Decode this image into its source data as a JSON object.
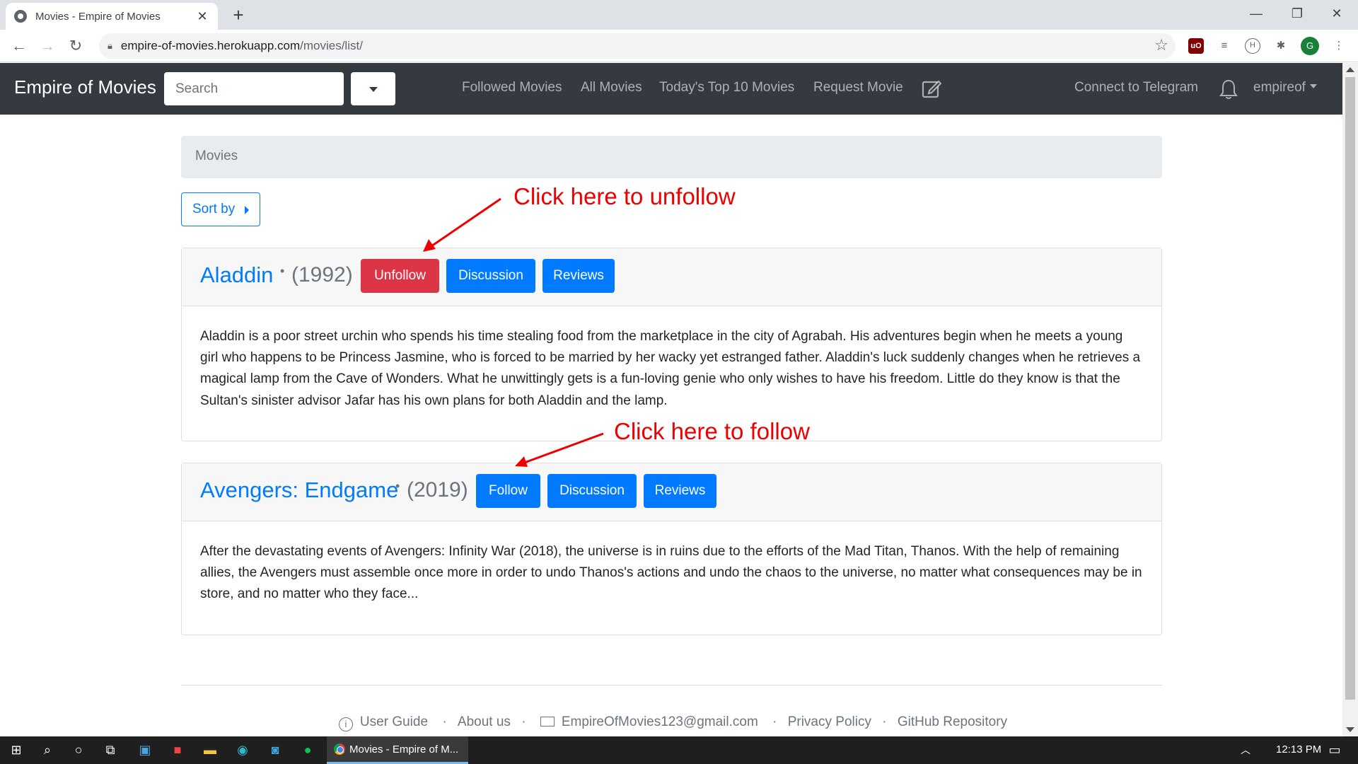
{
  "browser": {
    "tab_title": "Movies - Empire of Movies",
    "url_host": "empire-of-movies.herokuapp.com",
    "url_path": "/movies/list/",
    "profile_initial": "G"
  },
  "navbar": {
    "brand": "Empire of Movies",
    "search_placeholder": "Search",
    "links": {
      "followed": "Followed Movies",
      "all": "All Movies",
      "top10": "Today's Top 10 Movies",
      "request": "Request Movie",
      "telegram": "Connect to Telegram"
    },
    "username": "empireof"
  },
  "breadcrumb": "Movies",
  "sort_label": "Sort by",
  "movies": [
    {
      "title": "Aladdin",
      "year": "(1992)",
      "follow_label": "Unfollow",
      "discussion_label": "Discussion",
      "reviews_label": "Reviews",
      "description": "Aladdin is a poor street urchin who spends his time stealing food from the marketplace in the city of Agrabah. His adventures begin when he meets a young girl who happens to be Princess Jasmine, who is forced to be married by her wacky yet estranged father. Aladdin's luck suddenly changes when he retrieves a magical lamp from the Cave of Wonders. What he unwittingly gets is a fun-loving genie who only wishes to have his freedom. Little do they know is that the Sultan's sinister advisor Jafar has his own plans for both Aladdin and the lamp."
    },
    {
      "title": "Avengers: Endgame",
      "year": "(2019)",
      "follow_label": "Follow",
      "discussion_label": "Discussion",
      "reviews_label": "Reviews",
      "description": "After the devastating events of Avengers: Infinity War (2018), the universe is in ruins due to the efforts of the Mad Titan, Thanos. With the help of remaining allies, the Avengers must assemble once more in order to undo Thanos's actions and undo the chaos to the universe, no matter what consequences may be in store, and no matter who they face..."
    }
  ],
  "annotations": {
    "unfollow": "Click here to unfollow",
    "follow": "Click here to follow"
  },
  "footer": {
    "user_guide": "User Guide",
    "about": "About us",
    "email": "EmpireOfMovies123@gmail.com",
    "privacy": "Privacy Policy",
    "github": "GitHub Repository",
    "separator": "·"
  },
  "taskbar": {
    "active_window": "Movies - Empire of M...",
    "time": "12:13 PM"
  },
  "colors": {
    "primary": "#007bff",
    "danger": "#dc3545",
    "navbar": "#343a40",
    "annotation": "#ee0000"
  }
}
